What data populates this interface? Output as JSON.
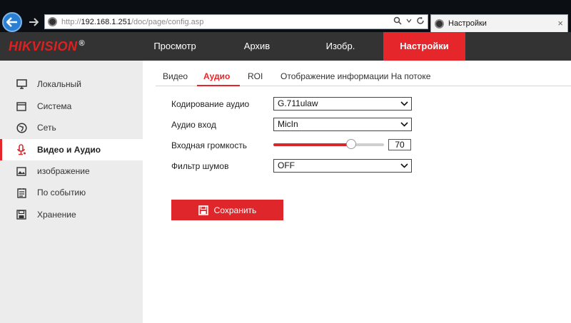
{
  "browser": {
    "url_prefix": "http://",
    "url_host": "192.168.1.251",
    "url_path": "/doc/page/config.asp",
    "tab_title": "Настройки",
    "tab_close": "×"
  },
  "brand": {
    "logo_red": "HIKVISION",
    "logo_reg": "®"
  },
  "topnav": [
    {
      "label": "Просмотр",
      "active": false
    },
    {
      "label": "Архив",
      "active": false
    },
    {
      "label": "Изобр.",
      "active": false
    },
    {
      "label": "Настройки",
      "active": true
    }
  ],
  "sidebar": [
    {
      "label": "Локальный",
      "icon": "monitor-icon",
      "active": false
    },
    {
      "label": "Система",
      "icon": "system-icon",
      "active": false
    },
    {
      "label": "Сеть",
      "icon": "network-icon",
      "active": false
    },
    {
      "label": "Видео и Аудио",
      "icon": "video-audio-icon",
      "active": true
    },
    {
      "label": "изображение",
      "icon": "image-icon",
      "active": false
    },
    {
      "label": "По событию",
      "icon": "event-icon",
      "active": false
    },
    {
      "label": "Хранение",
      "icon": "storage-icon",
      "active": false
    }
  ],
  "subtabs": [
    {
      "label": "Видео",
      "active": false
    },
    {
      "label": "Аудио",
      "active": true
    },
    {
      "label": "ROI",
      "active": false
    },
    {
      "label": "Отображение информации На потоке",
      "active": false
    }
  ],
  "form": {
    "audio_encoding": {
      "label": "Кодирование аудио",
      "value": "G.711ulaw"
    },
    "audio_input": {
      "label": "Аудио вход",
      "value": "MicIn"
    },
    "input_volume": {
      "label": "Входная громкость",
      "value": "70",
      "max": 100
    },
    "noise_filter": {
      "label": "Фильтр шумов",
      "value": "OFF"
    }
  },
  "save_label": "Сохранить",
  "colors": {
    "accent": "#e5262a",
    "topnav_bg": "#333333",
    "sidebar_bg": "#ececec"
  }
}
